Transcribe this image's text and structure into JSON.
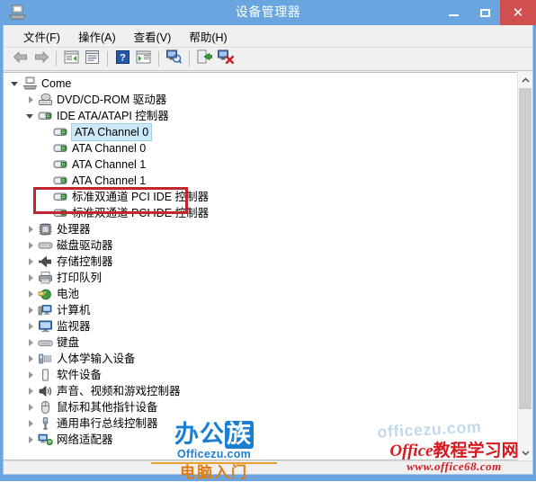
{
  "window": {
    "title": "设备管理器",
    "icon": "device-manager-icon",
    "minimize_label": "—",
    "maximize_label": "□",
    "close_label": "✕",
    "accent_titlebar": "#6aa5e0",
    "close_button_color": "#d05050"
  },
  "menubar": {
    "items": [
      {
        "label": "文件(F)",
        "name": "menu-file"
      },
      {
        "label": "操作(A)",
        "name": "menu-action"
      },
      {
        "label": "查看(V)",
        "name": "menu-view"
      },
      {
        "label": "帮助(H)",
        "name": "menu-help"
      }
    ]
  },
  "toolbar": {
    "buttons": [
      {
        "icon": "back-arrow-icon",
        "tip": "后退"
      },
      {
        "icon": "forward-arrow-icon",
        "tip": "前进"
      },
      {
        "icon": "show-hide-console-tree-icon",
        "tip": "显示/隐藏控制台树"
      },
      {
        "icon": "properties-icon",
        "tip": "属性"
      },
      {
        "icon": "help-icon",
        "tip": "帮助"
      },
      {
        "icon": "show-hide-action-pane-icon",
        "tip": "显示/隐藏操作窗格"
      },
      {
        "icon": "scan-hardware-changes-icon",
        "tip": "扫描检测硬件改动"
      },
      {
        "icon": "update-driver-icon",
        "tip": "更新驱动程序软件"
      },
      {
        "icon": "uninstall-device-icon",
        "tip": "卸载"
      }
    ]
  },
  "tree": {
    "selected_label": "ATA Channel 0",
    "annotation_color": "#c0262b",
    "nodes": [
      {
        "label": "Come",
        "indent": 0,
        "twisty": "expanded",
        "icon": "computer-icon",
        "selected": false
      },
      {
        "label": "DVD/CD-ROM 驱动器",
        "indent": 1,
        "twisty": "collapsed",
        "icon": "dvd-drive-icon",
        "selected": false
      },
      {
        "label": "IDE ATA/ATAPI 控制器",
        "indent": 1,
        "twisty": "expanded",
        "icon": "ide-controller-icon",
        "selected": false
      },
      {
        "label": "ATA Channel 0",
        "indent": 2,
        "twisty": "none",
        "icon": "ata-channel-icon",
        "selected": true
      },
      {
        "label": "ATA Channel 0",
        "indent": 2,
        "twisty": "none",
        "icon": "ata-channel-icon",
        "selected": false
      },
      {
        "label": "ATA Channel 1",
        "indent": 2,
        "twisty": "none",
        "icon": "ata-channel-icon",
        "selected": false
      },
      {
        "label": "ATA Channel 1",
        "indent": 2,
        "twisty": "none",
        "icon": "ata-channel-icon",
        "selected": false
      },
      {
        "label": "标准双通道 PCI IDE 控制器",
        "indent": 2,
        "twisty": "none",
        "icon": "ata-channel-icon",
        "selected": false
      },
      {
        "label": "标准双通道 PCI IDE 控制器",
        "indent": 2,
        "twisty": "none",
        "icon": "ata-channel-icon",
        "selected": false
      },
      {
        "label": "处理器",
        "indent": 1,
        "twisty": "collapsed",
        "icon": "processor-icon",
        "selected": false
      },
      {
        "label": "磁盘驱动器",
        "indent": 1,
        "twisty": "collapsed",
        "icon": "disk-drive-icon",
        "selected": false
      },
      {
        "label": "存储控制器",
        "indent": 1,
        "twisty": "collapsed",
        "icon": "storage-controller-icon",
        "selected": false
      },
      {
        "label": "打印队列",
        "indent": 1,
        "twisty": "collapsed",
        "icon": "printer-icon",
        "selected": false
      },
      {
        "label": "电池",
        "indent": 1,
        "twisty": "collapsed",
        "icon": "battery-icon",
        "selected": false
      },
      {
        "label": "计算机",
        "indent": 1,
        "twisty": "collapsed",
        "icon": "computer-node-icon",
        "selected": false
      },
      {
        "label": "监视器",
        "indent": 1,
        "twisty": "collapsed",
        "icon": "monitor-icon",
        "selected": false
      },
      {
        "label": "键盘",
        "indent": 1,
        "twisty": "collapsed",
        "icon": "keyboard-icon",
        "selected": false
      },
      {
        "label": "人体学输入设备",
        "indent": 1,
        "twisty": "collapsed",
        "icon": "hid-icon",
        "selected": false
      },
      {
        "label": "软件设备",
        "indent": 1,
        "twisty": "collapsed",
        "icon": "software-device-icon",
        "selected": false
      },
      {
        "label": "声音、视频和游戏控制器",
        "indent": 1,
        "twisty": "collapsed",
        "icon": "sound-icon",
        "selected": false
      },
      {
        "label": "鼠标和其他指针设备",
        "indent": 1,
        "twisty": "collapsed",
        "icon": "mouse-icon",
        "selected": false
      },
      {
        "label": "通用串行总线控制器",
        "indent": 1,
        "twisty": "collapsed",
        "icon": "usb-icon",
        "selected": false
      },
      {
        "label": "网络适配器",
        "indent": 1,
        "twisty": "collapsed",
        "icon": "network-adapter-icon",
        "selected": false
      }
    ]
  },
  "scrollbar": {
    "up_glyph": "⌃",
    "down_glyph": "⌄"
  },
  "watermarks": {
    "center": {
      "cn_a": "办公",
      "cn_b": "族",
      "url": "Officezu.com",
      "sub": "电脑入门"
    },
    "faint": "officezu.com",
    "right": {
      "line1_cn": "教程学习网",
      "line1_lat": "Office",
      "line2": "www.office68.com"
    }
  }
}
